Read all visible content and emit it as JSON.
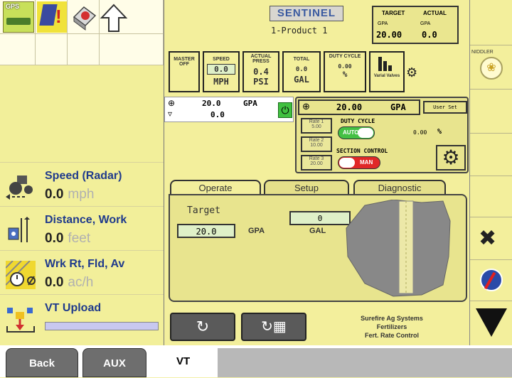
{
  "left": {
    "gps_label": "GPS",
    "rows": [
      {
        "label": "Speed (Radar)",
        "value": "0.0",
        "unit": "mph"
      },
      {
        "label": "Distance, Work",
        "value": "0.0",
        "unit": "feet"
      },
      {
        "label": "Wrk Rt, Fld, Av",
        "value": "0.0",
        "unit": "ac/h"
      },
      {
        "label": "VT Upload",
        "value": "",
        "unit": ""
      }
    ]
  },
  "bottom": {
    "back": "Back",
    "aux": "AUX",
    "vt": "VT"
  },
  "header": {
    "brand": "SENTINEL",
    "product": "1-Product 1",
    "target_label": "TARGET",
    "actual_label": "ACTUAL",
    "target_unit": "GPA",
    "actual_unit": "GPA",
    "target_value": "20.00",
    "actual_value": "0.0"
  },
  "gauges": {
    "master": "MASTER OFF",
    "speed_label": "SPEED",
    "speed_value": "0.0",
    "speed_unit": "MPH",
    "press_label": "ACTUAL PRESS",
    "press_value": "0.4",
    "press_unit": "PSI",
    "total_label": "TOTAL",
    "total_value": "0.0",
    "total_unit": "GAL",
    "duty_label": "DUTY CYCLE",
    "duty_value": "0.00",
    "duty_unit": "%",
    "valve_label": "Varial Valves"
  },
  "status": {
    "rate": "20.0",
    "rate_unit": "GPA",
    "rate2": "0.0"
  },
  "control": {
    "rate_value": "20.00",
    "rate_unit": "GPA",
    "user_set": "User Set",
    "rate1": "Rate 1",
    "rate1_val": "5.00",
    "rate2": "Rate 2",
    "rate2_val": "10.00",
    "rate3": "Rate 3",
    "rate3_val": "20.00",
    "duty_title": "DUTY CYCLE",
    "duty_toggle": "AUTO",
    "duty_val": "0.00",
    "duty_unit": "%",
    "section_title": "SECTION CONTROL",
    "section_toggle": "MAN"
  },
  "tabs": {
    "operate": "Operate",
    "setup": "Setup",
    "diagnostic": "Diagnostic"
  },
  "operate": {
    "target_label": "Target",
    "target_value": "20.0",
    "target_unit": "GPA",
    "total_value": "0",
    "total_unit": "GAL"
  },
  "footer": {
    "company": "Surefire Ag Systems",
    "line2": "Fertilizers",
    "line3": "Fert. Rate Control"
  },
  "right": {
    "top_label": "NIDDLER"
  }
}
